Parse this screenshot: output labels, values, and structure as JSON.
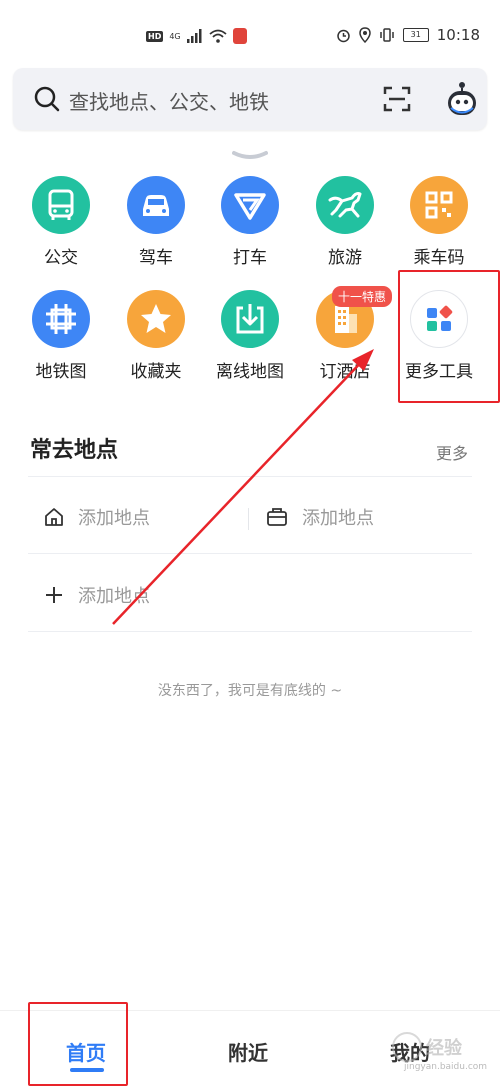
{
  "status_bar": {
    "hd_label": "HD",
    "signal_label": "4G",
    "time": "10:18",
    "battery_level": "31"
  },
  "search": {
    "placeholder": "查找地点、公交、地铁"
  },
  "tools": [
    {
      "label": "公交",
      "icon": "bus-icon",
      "color": "#22c1a0"
    },
    {
      "label": "驾车",
      "icon": "car-icon",
      "color": "#3e86f5"
    },
    {
      "label": "打车",
      "icon": "taxi-icon",
      "color": "#3e86f5"
    },
    {
      "label": "旅游",
      "icon": "horse-icon",
      "color": "#22c1a0"
    },
    {
      "label": "乘车码",
      "icon": "qrcode-icon",
      "color": "#f7a53b"
    },
    {
      "label": "地铁图",
      "icon": "subway-icon",
      "color": "#3e86f5"
    },
    {
      "label": "收藏夹",
      "icon": "star-icon",
      "color": "#f7a53b"
    },
    {
      "label": "离线地图",
      "icon": "download-icon",
      "color": "#22c1a0"
    },
    {
      "label": "订酒店",
      "icon": "hotel-icon",
      "color": "#f7a53b"
    },
    {
      "label": "更多工具",
      "icon": "apps-icon",
      "color": "#ffffff"
    }
  ],
  "promo_badge": "十一特惠",
  "frequent": {
    "title": "常去地点",
    "more": "更多",
    "home_label": "添加地点",
    "work_label": "添加地点",
    "add_label": "添加地点"
  },
  "footer_text": "没东西了，我可是有底线的 ~",
  "tabs": {
    "home": "首页",
    "nearby": "附近",
    "mine": "我的"
  },
  "colors": {
    "accent": "#2f7cf6",
    "annotation": "#e8242a"
  },
  "watermark": {
    "text": "经验",
    "url": "jingyan.baidu.com"
  }
}
